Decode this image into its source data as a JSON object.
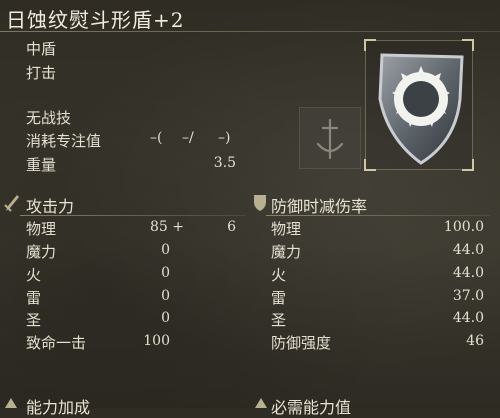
{
  "title": "日蚀纹熨斗形盾+2",
  "info": {
    "type": "中盾",
    "attack_type": "打击",
    "skill": "无战技",
    "fp_label": "消耗专注值",
    "fp_p1": "–(",
    "fp_p2": "–/",
    "fp_p3": "–)",
    "weight_label": "重量",
    "weight_value": "3.5"
  },
  "attack": {
    "header": "攻击力",
    "rows": [
      {
        "label": "物理",
        "value": "85 +",
        "extra": "6"
      },
      {
        "label": "魔力",
        "value": "0"
      },
      {
        "label": "火",
        "value": "0"
      },
      {
        "label": "雷",
        "value": "0"
      },
      {
        "label": "圣",
        "value": "0"
      },
      {
        "label": "致命一击",
        "value": "100"
      }
    ]
  },
  "guard": {
    "header": "防御时减伤率",
    "rows": [
      {
        "label": "物理",
        "value": "100.0"
      },
      {
        "label": "魔力",
        "value": "44.0"
      },
      {
        "label": "火",
        "value": "44.0"
      },
      {
        "label": "雷",
        "value": "37.0"
      },
      {
        "label": "圣",
        "value": "44.0"
      },
      {
        "label": "防御强度",
        "value": "46"
      }
    ]
  },
  "bottom": {
    "left_header": "能力加成",
    "right_header": "必需能力值"
  },
  "icons": {
    "attack_section": "sword-icon",
    "guard_section": "shield-icon",
    "ash_of_war": "ash-of-war-sword-icon",
    "item": "eclipse-heater-shield-icon"
  }
}
